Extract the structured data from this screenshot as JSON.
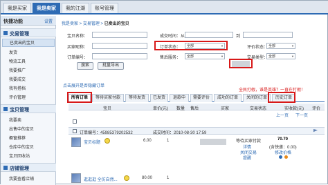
{
  "top_tabs": [
    "我是买家",
    "我是卖家",
    "我的江湖",
    "账号管理"
  ],
  "sidebar": {
    "head": "快捷功能",
    "setting": "设置",
    "groups": [
      {
        "label": "交易管理",
        "items": [
          "已卖出的宝贝",
          "发货",
          "物流工具",
          "我要推广",
          "我要成交",
          "我有搭档",
          "评价管理"
        ]
      },
      {
        "label": "宝贝管理",
        "items": [
          "我要卖",
          "出售中的宝贝",
          "橱窗推荐",
          "仓库中的宝贝",
          "宝贝回收站"
        ]
      },
      {
        "label": "店铺管理",
        "items": [
          "我要查看店铺"
        ]
      }
    ]
  },
  "breadcrumb": {
    "root": "我是卖家",
    "mid": "交易管理",
    "current": "已卖出的宝贝"
  },
  "search": {
    "item_name": "宝贝名称：",
    "deal_time": "成交时间：从",
    "to": "到",
    "buyer_nick": "买家昵称：",
    "order_status": "订单状态：",
    "order_status_value": "全部",
    "rate_status": "评价状态：",
    "rate_status_value": "全部",
    "order_no": "订单编号：",
    "after_sale": "售后服务：",
    "after_sale_value": "全部",
    "order_type": "交易类型：",
    "order_type_value": "全部",
    "search_button": "搜索",
    "batch_export": "批量导出"
  },
  "hint": "点击展开是否隐藏订单",
  "promo": "全民打假，谁是英雄？一直在打假！",
  "order_tabs": [
    "所有订单",
    "等待买家付款",
    "等待发货",
    "已发货",
    "退款中",
    "需要评价",
    "成功的订单",
    "关闭的订单",
    "历史订单"
  ],
  "columns": [
    "宝贝",
    "单价(元)",
    "数量",
    "售后",
    "买家",
    "交易状态",
    "实收款(元)",
    "评价"
  ],
  "pager": {
    "prev": "上一页",
    "next": "下一页"
  },
  "order": {
    "id_label": "订单编号：45985379202532",
    "time_label": "成交时间：2010-08-30 17:59"
  },
  "rows": [
    {
      "title": "宝贝标题",
      "price": "6.00",
      "qty": "1",
      "status": "等待买家付款",
      "detail": "详情",
      "close": "关闭交易",
      "remind": "提醒",
      "amount": "70.70",
      "amount_note": "(含快递：0.00)",
      "modify": "修改价格"
    },
    {
      "title": "逛逛逛 全仿自然...",
      "price": "80.00",
      "qty": "1"
    }
  ]
}
